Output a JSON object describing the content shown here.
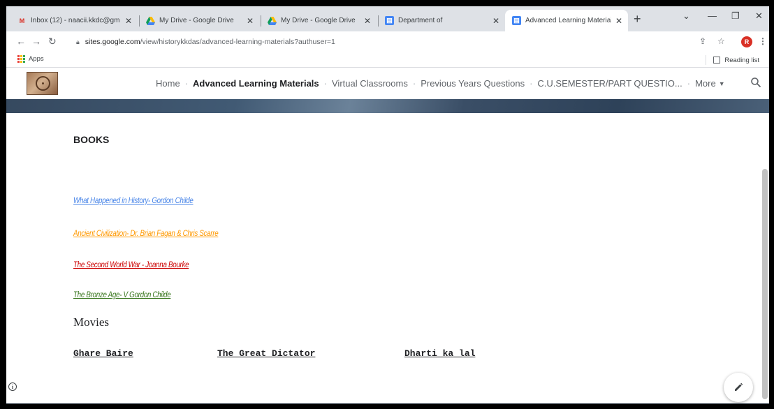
{
  "browser": {
    "tabs": [
      {
        "title": "Inbox (12) - naacii.kkdc@gm",
        "icon": "gmail-icon",
        "active": false
      },
      {
        "title": "My Drive - Google Drive",
        "icon": "drive-icon",
        "active": false
      },
      {
        "title": "My Drive - Google Drive",
        "icon": "drive-icon",
        "active": false
      },
      {
        "title": "Department of",
        "icon": "sites-icon",
        "active": false
      },
      {
        "title": "Advanced Learning Materials",
        "icon": "sites-icon",
        "active": true
      }
    ],
    "new_tab": "+",
    "close": "✕",
    "url_host": "sites.google.com",
    "url_path": "/view/historykkdas/advanced-learning-materials?authuser=1",
    "profile_initial": "R",
    "bookmarks": {
      "apps": "Apps",
      "reading_list": "Reading list"
    }
  },
  "site": {
    "nav": {
      "home": "Home",
      "advanced": "Advanced Learning Materials",
      "virtual": "Virtual Classrooms",
      "previous": "Previous Years Questions",
      "cu": "C.U.SEMESTER/PART QUESTIO...",
      "more": "More",
      "separator": "·"
    }
  },
  "content": {
    "books_heading": "BOOKS",
    "books": [
      {
        "title": "What Happened in History- Gordon Childe",
        "color": "#4a86e8"
      },
      {
        "title": "Ancient Civilization- Dr. Brian Fagan & Chris Scarre",
        "color": "#ff9900"
      },
      {
        "title": "The Second World War -  Joanna Bourke",
        "color": "#cc0000"
      },
      {
        "title": "The Bronze Age- V Gordon Childe",
        "color": "#38761d"
      }
    ],
    "movies_heading": "Movies",
    "movies": [
      "Ghare Baire",
      "The Great Dictator",
      "Dharti ka lal"
    ]
  }
}
